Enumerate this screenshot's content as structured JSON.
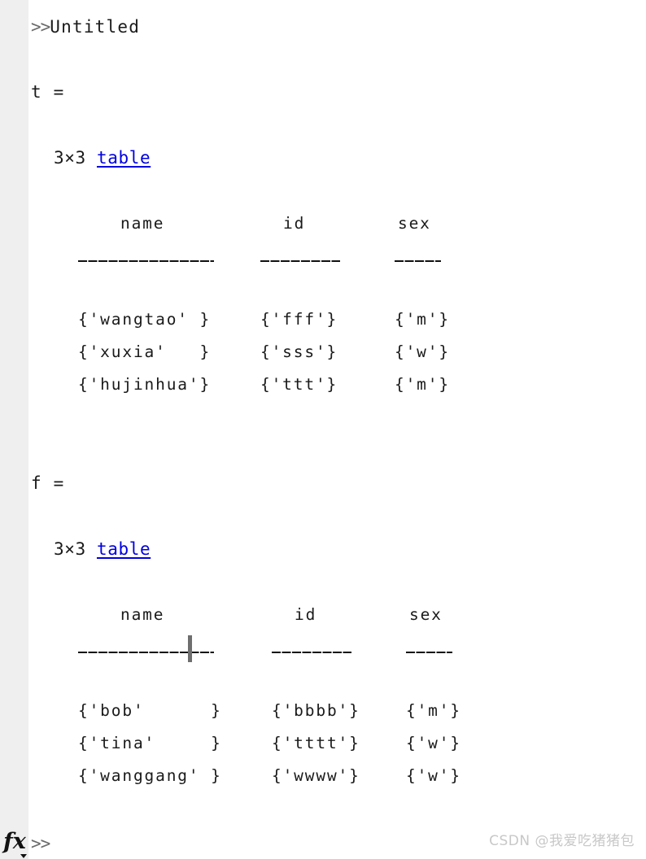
{
  "window": {
    "app": "MATLAB Command Window",
    "background_color": "#ffffff",
    "gutter_color": "#efefef",
    "text_color": "#1a1a1a",
    "link_color": "#0000e0",
    "prompt_color": "#6b6b6b",
    "caret_color": "#6e6e6e",
    "watermark_color": "#c8c8c8"
  },
  "command": {
    "prompt": ">>",
    "text": "Untitled"
  },
  "outputs": [
    {
      "variable_label": "t =",
      "size_prefix": "3×3",
      "type_link": "table",
      "columns": [
        {
          "header": "name",
          "rule": "____________"
        },
        {
          "header": "id",
          "rule": "_______"
        },
        {
          "header": "sex",
          "rule": "_____"
        }
      ],
      "rows": [
        {
          "name": "{'wangtao' }",
          "id": "{'fff'}",
          "sex": "{'m'}"
        },
        {
          "name": "{'xuxia'   }",
          "id": "{'sss'}",
          "sex": "{'w'}"
        },
        {
          "name": "{'hujinhua'}",
          "id": "{'ttt'}",
          "sex": "{'m'}"
        }
      ]
    },
    {
      "variable_label": "f =",
      "size_prefix": "3×3",
      "type_link": "table",
      "columns": [
        {
          "header": "name",
          "rule": "____________"
        },
        {
          "header": "id",
          "rule": "________"
        },
        {
          "header": "sex",
          "rule": "_____"
        }
      ],
      "rows": [
        {
          "name": "{'bob'      }",
          "id": "{'bbbb'}",
          "sex": "{'m'}"
        },
        {
          "name": "{'tina'     }",
          "id": "{'tttt'}",
          "sex": "{'w'}"
        },
        {
          "name": "{'wanggang' }",
          "id": "{'wwww'}",
          "sex": "{'w'}"
        }
      ]
    }
  ],
  "bottom": {
    "fx_label": "fx",
    "prompt": ">>"
  },
  "watermark": {
    "text": "CSDN @我爱吃猪猪包"
  }
}
